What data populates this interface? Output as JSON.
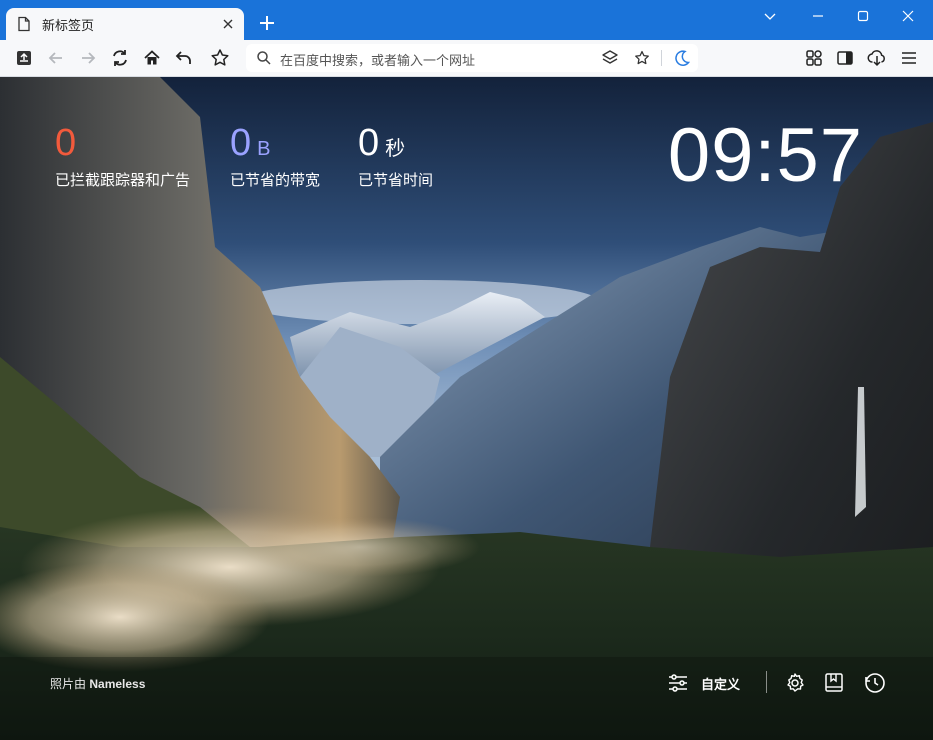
{
  "tab": {
    "title": "新标签页"
  },
  "address": {
    "placeholder": "在百度中搜索，或者输入一个网址"
  },
  "stats": {
    "trackers": {
      "value": "0",
      "unit": "",
      "label": "已拦截跟踪器和广告",
      "color": "#f25a3c"
    },
    "bandwidth": {
      "value": "0",
      "unit": "B",
      "label": "已节省的带宽",
      "color": "#9aa2ff"
    },
    "time": {
      "value": "0",
      "unit": "秒",
      "label": "已节省时间",
      "color": "#ffffff"
    }
  },
  "clock": "09:57",
  "credit": {
    "prefix": "照片由",
    "author": "Nameless"
  },
  "bottom": {
    "customize_label": "自定义"
  },
  "icons": [
    "doc-icon",
    "close-icon",
    "plus-icon",
    "chevron-down-icon",
    "minimize-icon",
    "maximize-icon",
    "close-window-icon",
    "share-icon",
    "back-icon",
    "forward-icon",
    "reload-icon",
    "home-icon",
    "undo-icon",
    "star-icon",
    "search-icon",
    "stack-icon",
    "bookmark-star-icon",
    "moon-icon",
    "extensions-icon",
    "sidebar-icon",
    "download-icon",
    "menu-icon",
    "sliders-icon",
    "gear-icon",
    "bookmark-icon",
    "history-icon"
  ]
}
